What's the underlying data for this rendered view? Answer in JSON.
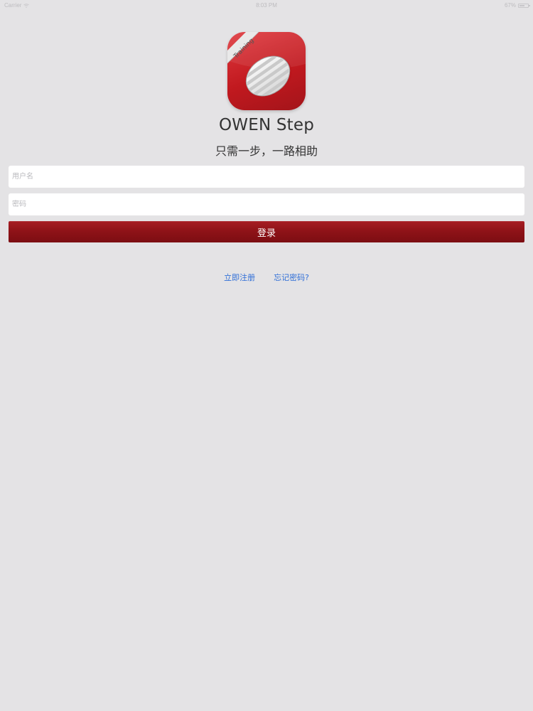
{
  "status_bar": {
    "carrier": "Carrier",
    "time": "8:03 PM",
    "battery_text": "67%",
    "battery_level": 0.67
  },
  "app": {
    "icon_badge": "Training",
    "name": "OWEN Step",
    "slogan": "只需一步，一路相助"
  },
  "form": {
    "username_placeholder": "用户名",
    "username_value": "",
    "password_placeholder": "密码",
    "password_value": "",
    "login_label": "登录"
  },
  "links": {
    "register": "立即注册",
    "forgot_password": "忘记密码?"
  },
  "colors": {
    "background": "#e4e3e5",
    "brand_red": "#c1191f",
    "button_red": "#8f1318",
    "link_blue": "#2f6ed7"
  }
}
